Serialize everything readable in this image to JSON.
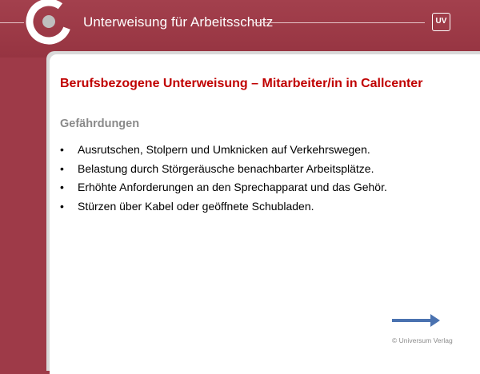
{
  "header": {
    "logo": "universum-ring-logo",
    "title": "Unterweisung für Arbeitsschutz",
    "badge": "UV",
    "badge_icon": "uv-logo-icon",
    "background_color": "#9e3a48"
  },
  "slide": {
    "title": "Berufsbezogene Unterweisung – Mitarbeiter/in in Callcenter",
    "title_color": "#c00000",
    "section_heading": "Gefährdungen",
    "bullet_symbol": "•",
    "bullets": [
      "Ausrutschen, Stolpern und Umknicken auf Verkehrswegen.",
      "Belastung durch Störgeräusche benachbarter Arbeitsplätze.",
      "Erhöhte Anforderungen an den Sprechapparat und das Gehör.",
      "Stürzen über Kabel oder geöffnete Schubladen."
    ]
  },
  "navigation": {
    "next_icon": "arrow-right-icon",
    "arrow_color": "#4a72b0"
  },
  "footer": {
    "copyright": "© Universum Verlag"
  }
}
